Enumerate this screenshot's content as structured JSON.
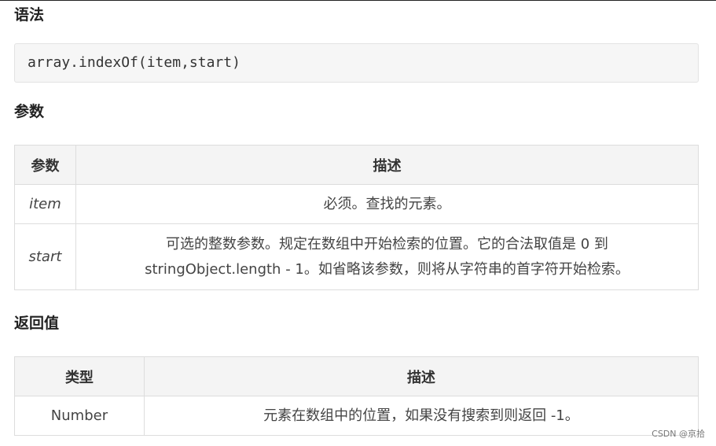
{
  "sections": {
    "syntax_title": "语法",
    "params_title": "参数",
    "return_title": "返回值"
  },
  "syntax": {
    "code": "array.indexOf(item,start)"
  },
  "params_table": {
    "headers": [
      "参数",
      "描述"
    ],
    "rows": [
      {
        "name": "item",
        "desc_line1": "必须。查找的元素。",
        "desc_line2": ""
      },
      {
        "name": "start",
        "desc_line1": "可选的整数参数。规定在数组中开始检索的位置。它的合法取值是 0 到",
        "desc_line2": "stringObject.length - 1。如省略该参数，则将从字符串的首字符开始检索。"
      }
    ]
  },
  "return_table": {
    "headers": [
      "类型",
      "描述"
    ],
    "rows": [
      {
        "type": "Number",
        "desc": "元素在数组中的位置，如果没有搜索到则返回 -1。"
      }
    ]
  },
  "watermark": "CSDN @京拾"
}
